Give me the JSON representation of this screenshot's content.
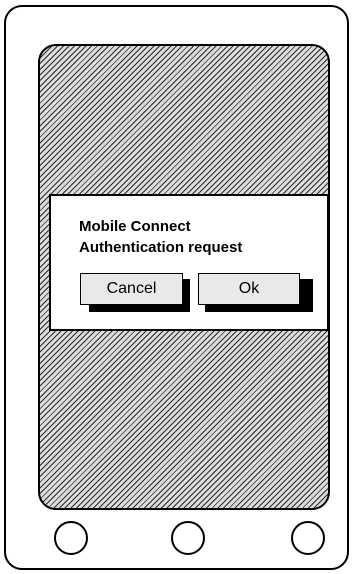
{
  "dialog": {
    "title_line1": "Mobile Connect",
    "title_line2": "Authentication request",
    "cancel_label": "Cancel",
    "ok_label": "Ok"
  },
  "nav_buttons": [
    "left-nav-button",
    "center-nav-button",
    "right-nav-button"
  ],
  "colors": {
    "frame": "#000000",
    "button_fill": "#e9e9e9",
    "dialog_fill": "#ffffff"
  }
}
